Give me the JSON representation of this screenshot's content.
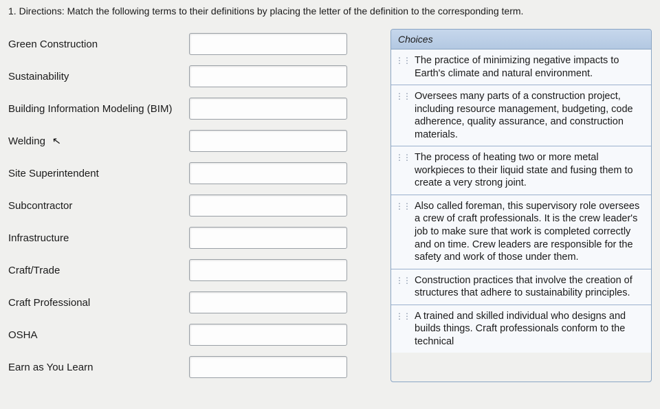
{
  "question_number": "1.",
  "directions": "Directions: Match the following terms to their definitions by placing the letter of the definition to the corresponding term.",
  "choices_header": "Choices",
  "drag_glyph": "⋮⋮",
  "terms": [
    {
      "label": "Green Construction"
    },
    {
      "label": "Sustainability"
    },
    {
      "label": "Building Information Modeling (BIM)"
    },
    {
      "label": "Welding"
    },
    {
      "label": "Site Superintendent"
    },
    {
      "label": "Subcontractor"
    },
    {
      "label": "Infrastructure"
    },
    {
      "label": "Craft/Trade"
    },
    {
      "label": "Craft Professional"
    },
    {
      "label": "OSHA"
    },
    {
      "label": "Earn as You Learn"
    }
  ],
  "choices": [
    {
      "text": "The practice of minimizing negative impacts to Earth's climate and natural environment."
    },
    {
      "text": "Oversees many parts of a construction project, including resource management, budgeting, code adherence, quality assurance, and construction materials."
    },
    {
      "text": "The process of heating two or more metal workpieces to their liquid state and fusing them to create a very strong joint."
    },
    {
      "text": "Also called foreman, this supervisory role oversees a crew of craft professionals. It is the crew leader's job to make sure that work is completed correctly and on time. Crew leaders are responsible for the safety and work of those under them."
    },
    {
      "text": "Construction practices that involve the creation of structures that adhere to sustainability principles."
    },
    {
      "text": "A trained and skilled individual who designs and builds things. Craft professionals conform to the technical"
    }
  ]
}
